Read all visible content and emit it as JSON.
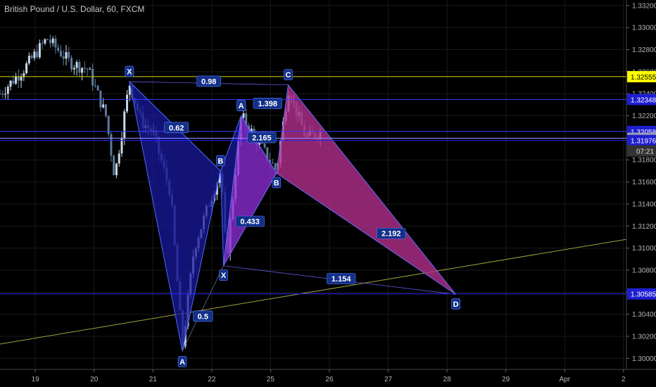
{
  "header": {
    "title": "British Pound / U.S. Dollar, 60, FXCM"
  },
  "chart_data": {
    "type": "candlestick",
    "title": "British Pound / U.S. Dollar, 60, FXCM",
    "ylim": [
      1.299,
      1.3325
    ],
    "y_ticks": [
      "1.30000",
      "1.30200",
      "1.30400",
      "1.30600",
      "1.30800",
      "1.31000",
      "1.31200",
      "1.31400",
      "1.31600",
      "1.31800",
      "1.32000",
      "1.32200",
      "1.32400",
      "1.32600",
      "1.32800",
      "1.33000",
      "1.33200"
    ],
    "x_ticks": [
      {
        "label": "19",
        "x": 19
      },
      {
        "label": "20",
        "x": 20
      },
      {
        "label": "21",
        "x": 21
      },
      {
        "label": "22",
        "x": 22
      },
      {
        "label": "25",
        "x": 23
      },
      {
        "label": "26",
        "x": 24
      },
      {
        "label": "27",
        "x": 25
      },
      {
        "label": "28",
        "x": 26
      },
      {
        "label": "29",
        "x": 27
      },
      {
        "label": "Apr",
        "x": 28
      },
      {
        "label": "2",
        "x": 29
      }
    ],
    "xlim": [
      18.4,
      29.05
    ],
    "grid": true,
    "horizontal_lines": [
      {
        "price": 1.32555,
        "color": "#d4d400",
        "label": "1.32555",
        "label_bg": "#ffff00",
        "label_color": "#000000"
      },
      {
        "price": 1.32348,
        "color": "#3a3aff",
        "label": "1.32348",
        "label_bg": "#1e1ed2",
        "label_color": "#ffffff"
      },
      {
        "price": 1.32058,
        "color": "#3a3aff",
        "label": "1.32058",
        "label_bg": "#1e1ed2",
        "label_color": "#ffffff"
      },
      {
        "price": 1.31996,
        "color": "#8a8aff",
        "label": "1.31996",
        "label_bg": "#9aa0b4",
        "label_color": "#ffffff"
      },
      {
        "price": 1.31976,
        "color": "#2020ff",
        "label": "1.31976",
        "label_bg": "#1e1ed2",
        "label_color": "#ffffff"
      },
      {
        "price": 1.30585,
        "color": "#2a2aff",
        "label": "1.30585",
        "label_bg": "#1e1ed2",
        "label_color": "#ffffff"
      }
    ],
    "countdown_label": "07:21",
    "trendline": {
      "x1": 18.4,
      "y1": 1.3013,
      "x2": 29.05,
      "y2": 1.3108,
      "color": "#a0a040"
    },
    "pattern1": {
      "points": [
        {
          "name": "X",
          "x": 20.6,
          "y": 1.3251
        },
        {
          "name": "A",
          "x": 21.5,
          "y": 1.3007
        },
        {
          "name": "B",
          "x": 22.15,
          "y": 1.317
        },
        {
          "name": "C",
          "x": 22.5,
          "y": 1.322
        },
        {
          "name": "D",
          "x": 22.2,
          "y": 1.3084
        }
      ],
      "fill": "#1a1a9c",
      "ratios": [
        {
          "label": "0.62",
          "x": 21.4,
          "y": 1.3209
        },
        {
          "label": "0.5",
          "x": 21.85,
          "y": 1.3038
        }
      ]
    },
    "pattern2": {
      "points": [
        {
          "name": "X",
          "x": 22.2,
          "y": 1.3084
        },
        {
          "name": "A",
          "x": 22.5,
          "y": 1.322
        },
        {
          "name": "B",
          "x": 23.1,
          "y": 1.3168
        },
        {
          "name": "C",
          "x": 23.3,
          "y": 1.3248
        },
        {
          "name": "D",
          "x": 26.15,
          "y": 1.3058
        }
      ],
      "fill_xab": "#8a2ad0",
      "fill_bcd": "#b0308a",
      "ratios": [
        {
          "label": "1.398",
          "x": 22.95,
          "y": 1.3231
        },
        {
          "label": "2.165",
          "x": 22.85,
          "y": 1.32
        },
        {
          "label": "0.433",
          "x": 22.65,
          "y": 1.3124
        },
        {
          "label": "2.192",
          "x": 25.05,
          "y": 1.3113
        },
        {
          "label": "1.154",
          "x": 24.2,
          "y": 1.3072
        },
        {
          "label": "0.98",
          "x": 21.95,
          "y": 1.3251
        }
      ]
    }
  }
}
